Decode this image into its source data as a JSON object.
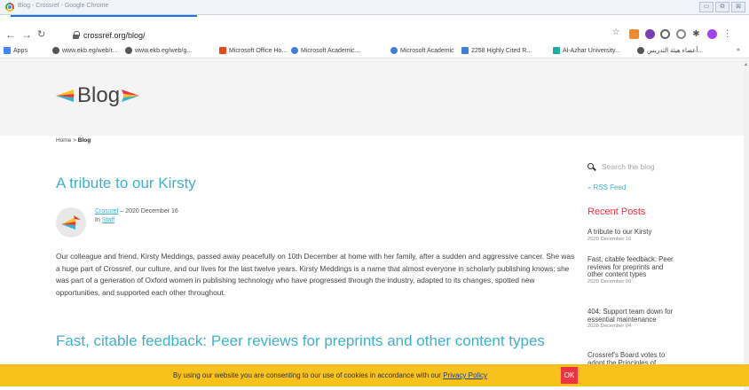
{
  "window": {
    "title": "Blog - Crossref - Google Chrome"
  },
  "toolbar": {
    "url": "crossref.org/blog/"
  },
  "bookmarks": {
    "items": [
      {
        "label": "Apps"
      },
      {
        "label": "www.ekb.eg/web/r..."
      },
      {
        "label": "www.ekb.eg/web/g..."
      },
      {
        "label": "Microsoft Office Ho..."
      },
      {
        "label": "Microsoft Academic..."
      },
      {
        "label": "Microsoft Academic"
      },
      {
        "label": "2258 Highly Cited R..."
      },
      {
        "label": "Al-Azhar University..."
      },
      {
        "label": "أعضاء هيئة التدريس..."
      }
    ],
    "more": "»"
  },
  "site": {
    "logo_text": "Blog"
  },
  "breadcrumb": {
    "home": "Home",
    "sep": ">",
    "current": "Blog"
  },
  "posts": [
    {
      "title": "A tribute to our Kirsty",
      "author": "Crossref",
      "date_text": "– 2020 December 16",
      "in_label": "In",
      "category": "Staff",
      "excerpt": "Our colleague and friend, Kirsty Meddings, passed away peacefully on 10th December at home with her family, after a sudden and aggressive cancer. She was a huge part of Crossref, our culture, and our lives for the last twelve years. Kirsty Meddings is a name that almost everyone in scholarly publishing knows; she was part of a generation of Oxford women in publishing technology who have progressed through the industry, adapted to its changes, spotted new opportunities, and supported each other throughout."
    },
    {
      "title": "Fast, citable feedback: Peer reviews for preprints and other content types"
    }
  ],
  "sidebar": {
    "search_placeholder": "Search the blog",
    "rss_label": "RSS Feed",
    "recent_heading": "Recent Posts",
    "recent": [
      {
        "title": "A tribute to our Kirsty",
        "date": "2020 December 16"
      },
      {
        "title": "Fast, citable feedback: Peer reviews for preprints and other content types",
        "date": "2020 December 09"
      },
      {
        "title": "404: Support team down for essential maintenance",
        "date": "2020 December 04"
      },
      {
        "title": "Crossref's Board votes to adopt the Principles of",
        "date": ""
      }
    ]
  },
  "cookie": {
    "text": "By using our website you are consenting to our use of cookies in accordance with our",
    "link": "Privacy Policy",
    "ok": "OK"
  },
  "colors": {
    "accent": "#3eb1c8",
    "red": "#ef3340",
    "cookie_bg": "#f7c21c"
  }
}
